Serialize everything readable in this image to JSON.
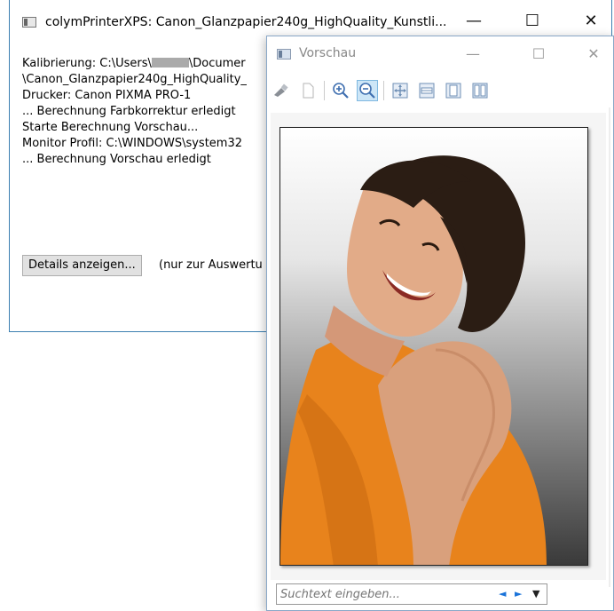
{
  "main_window": {
    "title": "colymPrinterXPS: Canon_Glanzpapier240g_HighQuality_Kunstli...",
    "controls": {
      "minimize": "—",
      "maximize": "☐",
      "close": "✕"
    },
    "log_lines": [
      {
        "prefix": "Kalibrierung: C:\\Users\\",
        "suffix": "\\Documer"
      },
      "\\Canon_Glanzpapier240g_HighQuality_",
      "Drucker: Canon PIXMA PRO-1",
      "... Berechnung Farbkorrektur erledigt",
      "Starte Berechnung Vorschau...",
      "Monitor Profil: C:\\WINDOWS\\system32",
      "... Berechnung Vorschau erledigt"
    ],
    "details_button": "Details anzeigen...",
    "details_note": "(nur zur Auswertu"
  },
  "preview_window": {
    "title": "Vorschau",
    "controls": {
      "minimize": "—",
      "maximize": "☐",
      "close": "✕"
    },
    "toolbar_icons": [
      "print-icon",
      "page-icon",
      "zoom-in-icon",
      "zoom-out-icon",
      "fit-page-icon",
      "fit-width-icon",
      "single-page-icon",
      "two-pages-icon"
    ],
    "search": {
      "placeholder": "Suchtext eingeben..."
    },
    "nav": {
      "prev": "◄",
      "next": "►",
      "dropdown": "▼"
    }
  },
  "colors": {
    "accent": "#3c7fb1",
    "shirt": "#e8831c",
    "hair": "#2b1d14",
    "skin": "#d9a07c"
  }
}
